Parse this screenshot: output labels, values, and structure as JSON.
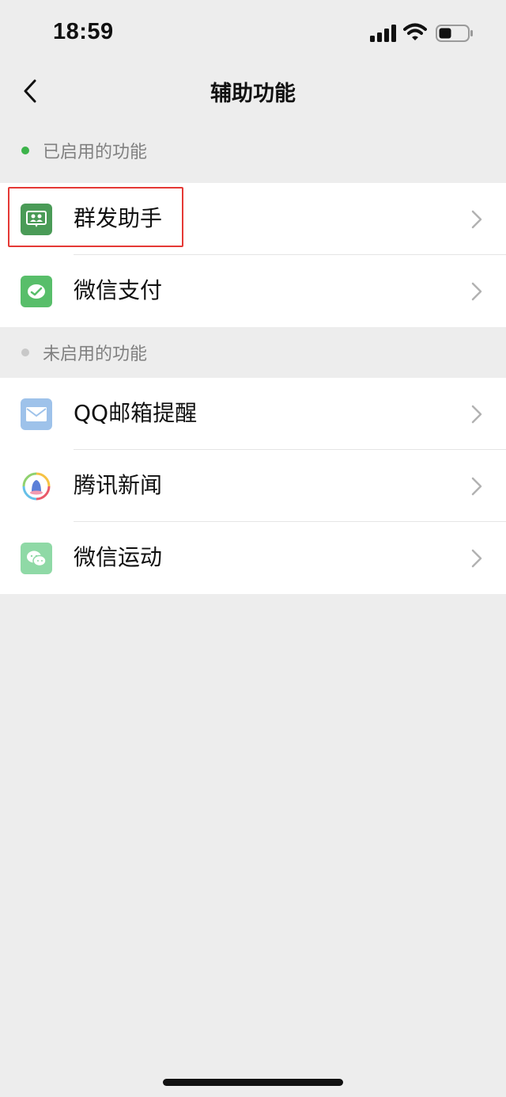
{
  "status_bar": {
    "time": "18:59",
    "icons": [
      "signal-icon",
      "wifi-icon",
      "battery-icon"
    ]
  },
  "nav": {
    "title": "辅助功能",
    "back_icon": "chevron-left-icon"
  },
  "enabled_section": {
    "label": "已启用的功能",
    "dot_color": "#3cb34a",
    "items": [
      {
        "label": "群发助手",
        "icon": "mass-message-icon",
        "icon_color": "#4a9b57",
        "highlighted": true
      },
      {
        "label": "微信支付",
        "icon": "wechat-pay-icon",
        "icon_color": "#58be6a"
      }
    ]
  },
  "disabled_section": {
    "label": "未启用的功能",
    "dot_color": "#c8c8c8",
    "items": [
      {
        "label": "QQ邮箱提醒",
        "icon": "mail-icon",
        "icon_color": "#9ec2ea"
      },
      {
        "label": "腾讯新闻",
        "icon": "tencent-news-icon",
        "icon_color": "#ffffff"
      },
      {
        "label": "微信运动",
        "icon": "wechat-sports-icon",
        "icon_color": "#8fd9a6"
      }
    ]
  },
  "colors": {
    "background": "#ededed",
    "highlight_border": "#e53935",
    "chevron": "#b2b2b2"
  }
}
